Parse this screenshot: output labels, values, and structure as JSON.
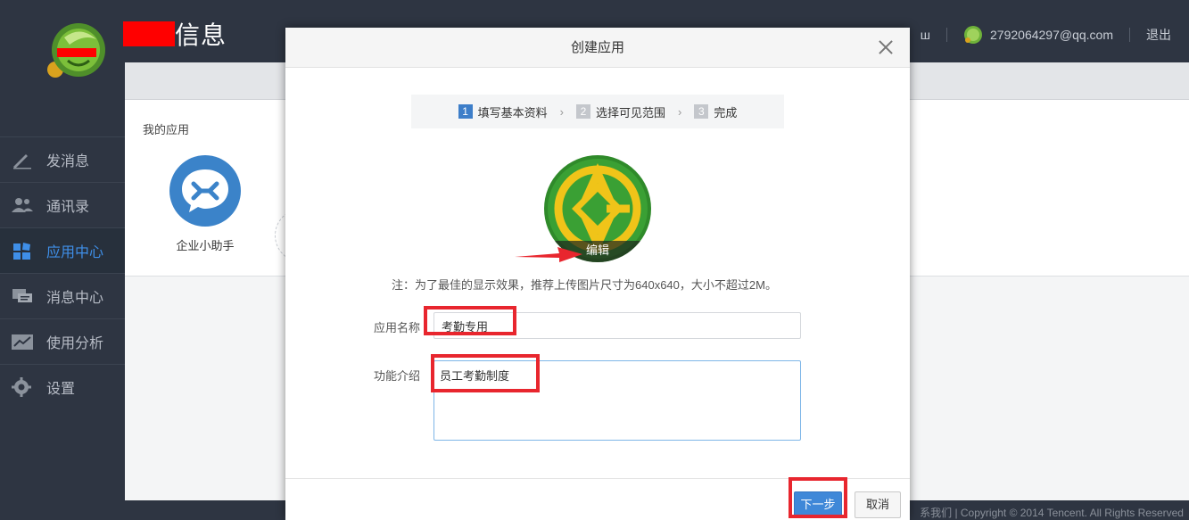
{
  "app": {
    "title_suffix": "信息",
    "user_email": "2792064297@qq.com",
    "logout": "退出",
    "topbar_partial": "ш"
  },
  "sidebar": {
    "items": [
      {
        "label": "发消息",
        "icon": "pencil-icon"
      },
      {
        "label": "通讯录",
        "icon": "contacts-icon"
      },
      {
        "label": "应用中心",
        "icon": "apps-icon"
      },
      {
        "label": "消息中心",
        "icon": "messages-icon"
      },
      {
        "label": "使用分析",
        "icon": "chart-icon"
      },
      {
        "label": "设置",
        "icon": "gear-icon"
      }
    ],
    "active_index": 2
  },
  "main": {
    "my_apps_label": "我的应用",
    "apps": [
      {
        "name": "企业小助手"
      }
    ],
    "footer": "系我们 | Copyright © 2014 Tencent. All Rights Reserved"
  },
  "modal": {
    "title": "创建应用",
    "steps": [
      {
        "num": "1",
        "label": "填写基本资料",
        "active": true
      },
      {
        "num": "2",
        "label": "选择可见范围",
        "active": false
      },
      {
        "num": "3",
        "label": "完成",
        "active": false
      }
    ],
    "logo_edit": "编辑",
    "note": "注：为了最佳的显示效果，推荐上传图片尺寸为640x640，大小不超过2M。",
    "name_label": "应用名称",
    "name_value": "考勤专用",
    "desc_label": "功能介绍",
    "desc_value": "员工考勤制度",
    "next_button": "下一步",
    "cancel_button": "取消"
  },
  "colors": {
    "sidebar_bg": "#2e3542",
    "accent": "#3f88d8",
    "highlight": "#e8262e"
  }
}
